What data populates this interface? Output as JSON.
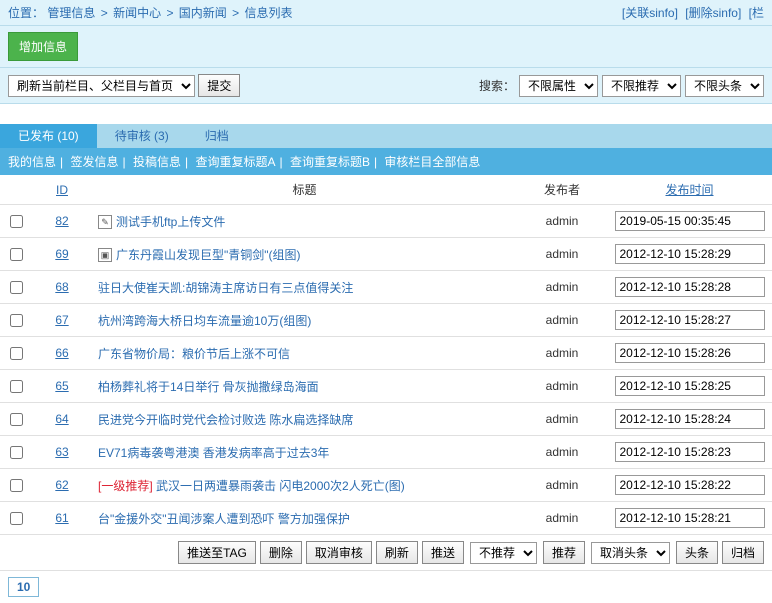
{
  "crumb": {
    "label": "位置：",
    "items": [
      "管理信息",
      "新闻中心",
      "国内新闻",
      "信息列表"
    ],
    "right_links": [
      "[关联sinfo]",
      "[删除sinfo]",
      "[栏"
    ]
  },
  "add_button": "增加信息",
  "refresh": {
    "select": "刷新当前栏目、父栏目与首页",
    "submit": "提交"
  },
  "search": {
    "label": "搜索：",
    "sel_attr": "不限属性",
    "sel_rec": "不限推荐",
    "sel_head": "不限头条"
  },
  "tabs": [
    {
      "label": "已发布 (10)",
      "active": true
    },
    {
      "label": "待审核 (3)",
      "active": false
    },
    {
      "label": "归档",
      "active": false
    }
  ],
  "filters": [
    "我的信息",
    "签发信息",
    "投稿信息",
    "查询重复标题A",
    "查询重复标题B",
    "审核栏目全部信息"
  ],
  "columns": {
    "id": "ID",
    "title": "标题",
    "publisher": "发布者",
    "time": "发布时间"
  },
  "rows": [
    {
      "id": "82",
      "icon": "doc",
      "title": "测试手机ftp上传文件",
      "publisher": "admin",
      "time": "2019-05-15 00:35:45"
    },
    {
      "id": "69",
      "icon": "img",
      "title": "广东丹霞山发现巨型\"青铜剑\"(组图)",
      "publisher": "admin",
      "time": "2012-12-10 15:28:29"
    },
    {
      "id": "68",
      "icon": "",
      "title": "驻日大使崔天凯:胡锦涛主席访日有三点值得关注",
      "publisher": "admin",
      "time": "2012-12-10 15:28:28"
    },
    {
      "id": "67",
      "icon": "",
      "title": "杭州湾跨海大桥日均车流量逾10万(组图)",
      "publisher": "admin",
      "time": "2012-12-10 15:28:27"
    },
    {
      "id": "66",
      "icon": "",
      "title": "广东省物价局：粮价节后上涨不可信",
      "publisher": "admin",
      "time": "2012-12-10 15:28:26"
    },
    {
      "id": "65",
      "icon": "",
      "title": "柏杨葬礼将于14日举行 骨灰抛撒绿岛海面",
      "publisher": "admin",
      "time": "2012-12-10 15:28:25"
    },
    {
      "id": "64",
      "icon": "",
      "title": "民进党今开临时党代会检讨败选 陈水扁选择缺席",
      "publisher": "admin",
      "time": "2012-12-10 15:28:24"
    },
    {
      "id": "63",
      "icon": "",
      "title": "EV71病毒袭粤港澳 香港发病率高于过去3年",
      "publisher": "admin",
      "time": "2012-12-10 15:28:23"
    },
    {
      "id": "62",
      "icon": "",
      "prefix": "[一级推荐]",
      "title": "武汉一日两遭暴雨袭击 闪电2000次2人死亡(图)",
      "publisher": "admin",
      "time": "2012-12-10 15:28:22"
    },
    {
      "id": "61",
      "icon": "",
      "title": "台\"金援外交\"丑闻涉案人遭到恐吓 警方加强保护",
      "publisher": "admin",
      "time": "2012-12-10 15:28:21"
    }
  ],
  "actions": {
    "push_tag": "推送至TAG",
    "delete": "删除",
    "cancel_audit": "取消审核",
    "refresh": "刷新",
    "push": "推送",
    "rec_select": "不推荐",
    "rec_btn": "推荐",
    "head_select": "取消头条",
    "head_btn": "头条",
    "archive": "归档"
  },
  "pager": {
    "current": "10"
  }
}
